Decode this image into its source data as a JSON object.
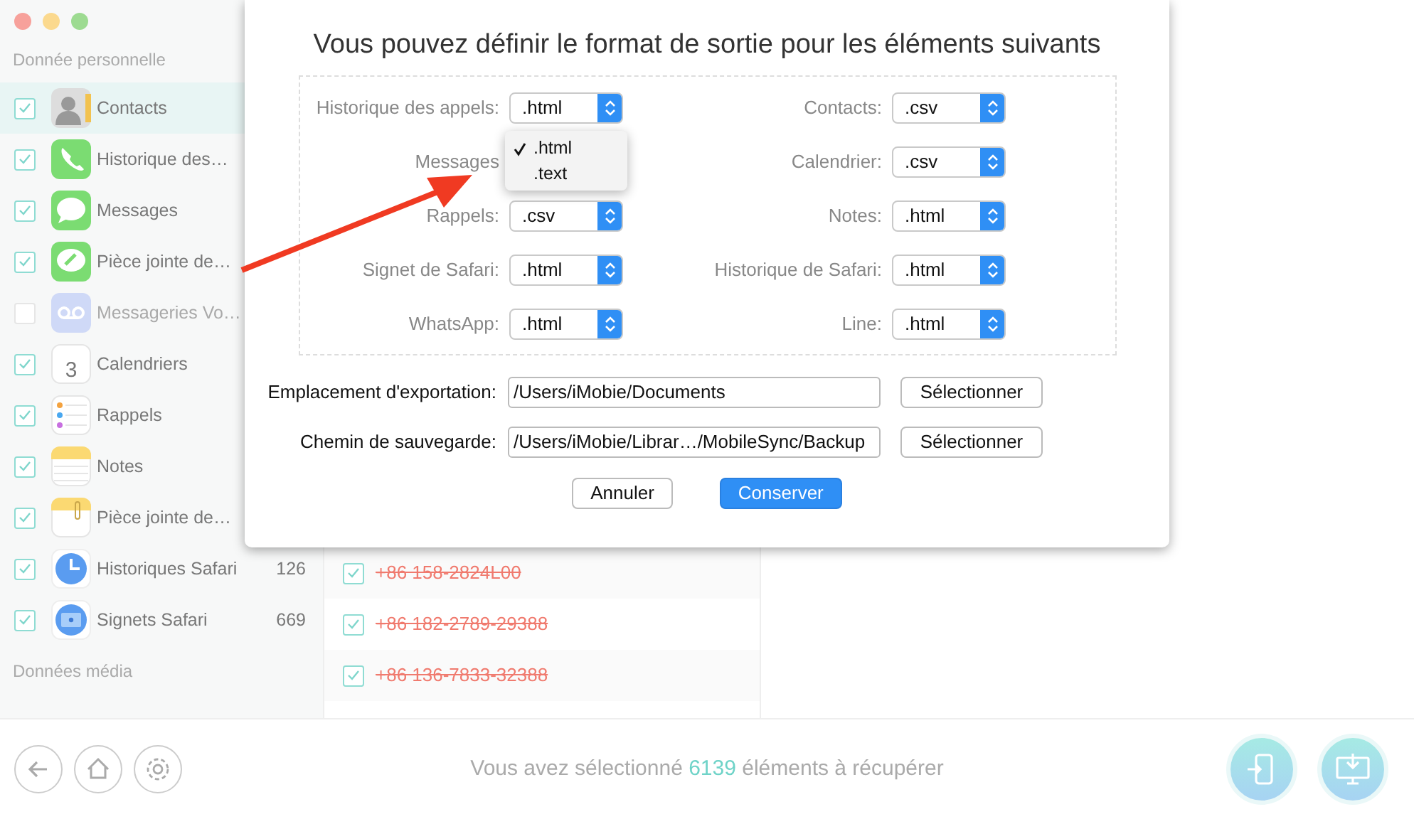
{
  "sidebar": {
    "sections": [
      {
        "title": "Donnée personnelle",
        "items": [
          {
            "kind": "contacts",
            "label": "Contacts",
            "checked": true,
            "selected": true,
            "disabled": false
          },
          {
            "kind": "phone",
            "label": "Historique des…",
            "checked": true,
            "selected": false,
            "disabled": false
          },
          {
            "kind": "messages",
            "label": "Messages",
            "checked": true,
            "selected": false,
            "disabled": false
          },
          {
            "kind": "attachment",
            "label": "Pièce jointe de…",
            "checked": true,
            "selected": false,
            "disabled": false
          },
          {
            "kind": "voicemail",
            "label": "Messageries Vo…",
            "checked": false,
            "selected": false,
            "disabled": true
          },
          {
            "kind": "calendar",
            "label": "Calendriers",
            "icon_text": "3",
            "checked": true,
            "selected": false,
            "disabled": false
          },
          {
            "kind": "reminders",
            "label": "Rappels",
            "checked": true,
            "selected": false,
            "disabled": false
          },
          {
            "kind": "notes",
            "label": "Notes",
            "checked": true,
            "selected": false,
            "disabled": false
          },
          {
            "kind": "note_attachment",
            "label": "Pièce jointe de…",
            "checked": true,
            "selected": false,
            "disabled": false
          },
          {
            "kind": "safari_history",
            "label": "Historiques Safari",
            "count": "126",
            "checked": true,
            "selected": false,
            "disabled": false
          },
          {
            "kind": "safari_bookmarks",
            "label": "Signets Safari",
            "count": "669",
            "checked": true,
            "selected": false,
            "disabled": false
          }
        ]
      },
      {
        "title": "Données média"
      }
    ]
  },
  "record_list": [
    {
      "number": "+86 158-2824L00",
      "checked": true
    },
    {
      "number": "+86 182-2789-29388",
      "checked": true
    },
    {
      "number": "+86 136-7833-32388",
      "checked": true
    }
  ],
  "dialog": {
    "title": "Vous pouvez définir le format de sortie pour les éléments suivants",
    "formats": [
      {
        "label": "Historique des appels:",
        "value": ".html"
      },
      {
        "label": "Contacts:",
        "value": ".csv"
      },
      {
        "label": "Messages",
        "menu": [
          {
            "label": ".html",
            "selected": true
          },
          {
            "label": ".text",
            "selected": false
          }
        ]
      },
      {
        "label": "Calendrier:",
        "value": ".csv"
      },
      {
        "label": "Rappels:",
        "value": ".csv"
      },
      {
        "label": "Notes:",
        "value": ".html"
      },
      {
        "label": "Signet de Safari:",
        "value": ".html"
      },
      {
        "label": "Historique de Safari:",
        "value": ".html"
      },
      {
        "label": "WhatsApp:",
        "value": ".html"
      },
      {
        "label": "Line:",
        "value": ".html"
      }
    ],
    "paths": [
      {
        "label": "Emplacement d'exportation:",
        "value": "/Users/iMobie/Documents",
        "button": "Sélectionner"
      },
      {
        "label": "Chemin de sauvegarde:",
        "value": "/Users/iMobie/Librar…/MobileSync/Backup",
        "button": "Sélectionner"
      }
    ],
    "buttons": [
      {
        "label": "Annuler",
        "primary": false
      },
      {
        "label": "Conserver",
        "primary": true
      }
    ]
  },
  "status": {
    "prefix": "Vous avez sélectionné",
    "count": "6139",
    "suffix": "éléments à récupérer"
  }
}
